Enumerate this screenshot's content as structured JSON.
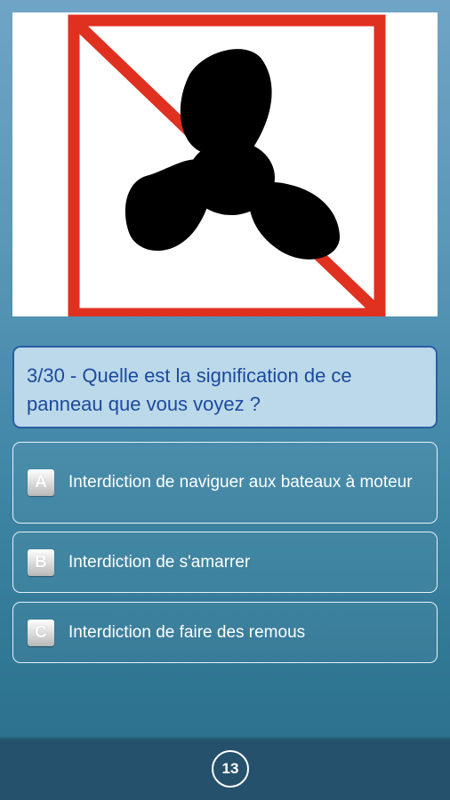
{
  "sign": {
    "icon": "no-motorboat-propeller-sign",
    "border_color": "#e03020",
    "propeller_color": "#000000"
  },
  "question": {
    "text": "3/30 - Quelle est la signification de ce panneau que vous voyez ?"
  },
  "answers": [
    {
      "letter": "A",
      "text": "Interdiction de naviguer aux bateaux à moteur"
    },
    {
      "letter": "B",
      "text": "Interdiction de s'amarrer"
    },
    {
      "letter": "C",
      "text": "Interdiction de faire des remous"
    }
  ],
  "footer": {
    "counter": "13"
  },
  "colors": {
    "question_text": "#1b4a9d",
    "question_border": "#2a5da3",
    "question_bg": "#bcd9ea",
    "bottom_bar": "#26516d"
  }
}
